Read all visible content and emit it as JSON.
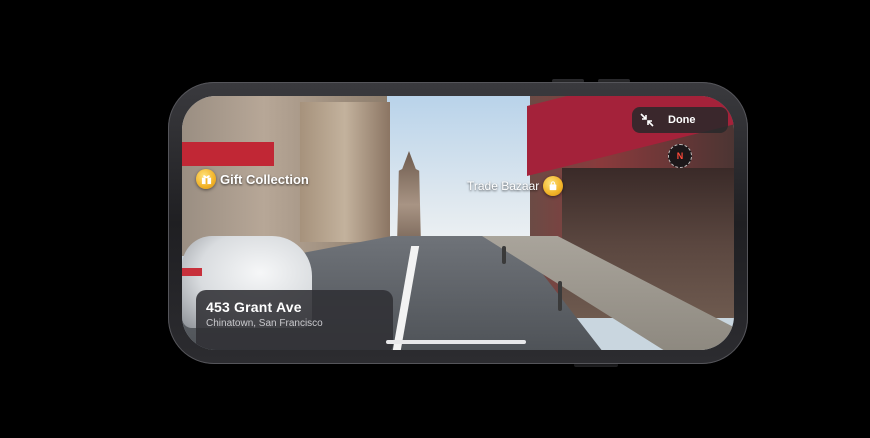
{
  "location_card": {
    "title": "453 Grant Ave",
    "subtitle": "Chinatown, San Francisco"
  },
  "pois": [
    {
      "label": "Gift Collection",
      "icon": "gift-icon"
    },
    {
      "label": "Trade Bazaar",
      "icon": "shopping-bag-icon"
    }
  ],
  "done_button": {
    "label": "Done",
    "icon": "collapse-arrows-icon"
  },
  "compass": {
    "label": "N",
    "icon": "compass-icon"
  },
  "colors": {
    "poi_pin": "#f2b327",
    "compass_north": "#ff4a3a"
  }
}
